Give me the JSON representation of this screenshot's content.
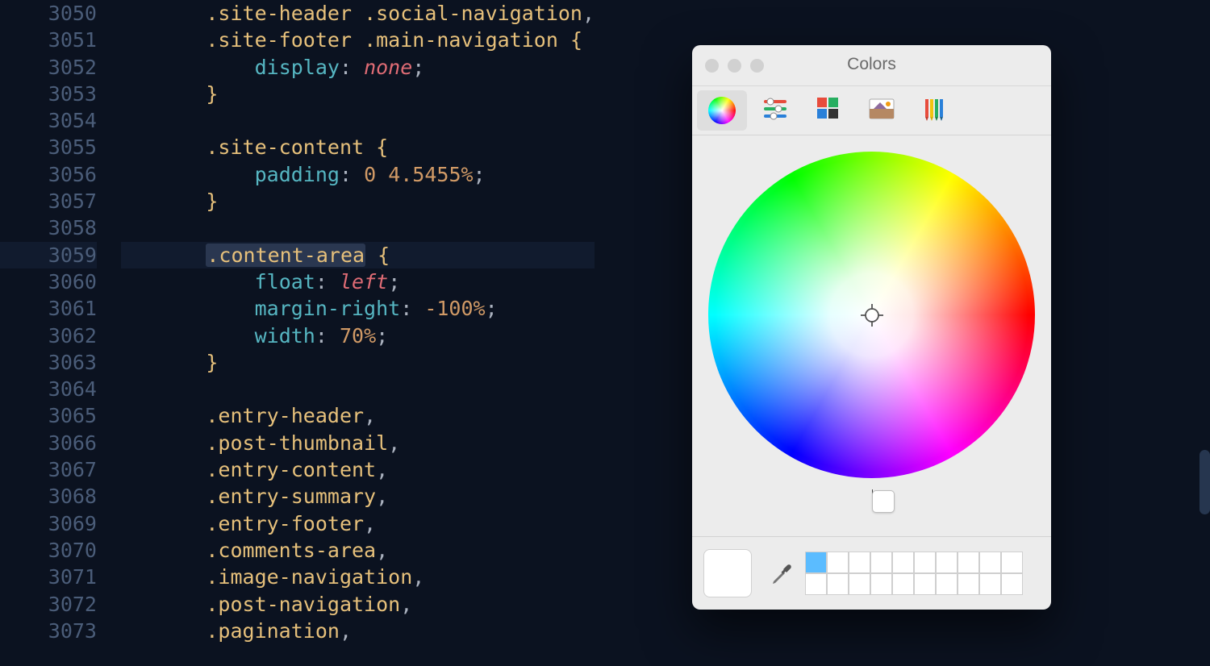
{
  "editor": {
    "gutter_start": 3050,
    "gutter_count": 24,
    "current_line": 3059,
    "lines": [
      {
        "n": 3050,
        "tokens": [
          {
            "t": "ind",
            "v": "····"
          },
          {
            "t": "sel",
            "v": ".site-header"
          },
          {
            "t": "punct",
            "v": " "
          },
          {
            "t": "sel",
            "v": ".social-navigation"
          },
          {
            "t": "punct",
            "v": ","
          }
        ]
      },
      {
        "n": 3051,
        "tokens": [
          {
            "t": "ind",
            "v": "····"
          },
          {
            "t": "sel",
            "v": ".site-footer"
          },
          {
            "t": "punct",
            "v": " "
          },
          {
            "t": "sel",
            "v": ".main-navigation"
          },
          {
            "t": "punct",
            "v": " "
          },
          {
            "t": "brace",
            "v": "{"
          }
        ]
      },
      {
        "n": 3052,
        "tokens": [
          {
            "t": "ind",
            "v": "····"
          },
          {
            "t": "ind",
            "v": "····"
          },
          {
            "t": "prop",
            "v": "display"
          },
          {
            "t": "punct",
            "v": ": "
          },
          {
            "t": "kw-it",
            "v": "none"
          },
          {
            "t": "punct",
            "v": ";"
          }
        ]
      },
      {
        "n": 3053,
        "tokens": [
          {
            "t": "ind",
            "v": "····"
          },
          {
            "t": "brace",
            "v": "}"
          }
        ]
      },
      {
        "n": 3054,
        "tokens": []
      },
      {
        "n": 3055,
        "tokens": [
          {
            "t": "ind",
            "v": "····"
          },
          {
            "t": "sel",
            "v": ".site-content"
          },
          {
            "t": "punct",
            "v": " "
          },
          {
            "t": "brace",
            "v": "{"
          }
        ]
      },
      {
        "n": 3056,
        "tokens": [
          {
            "t": "ind",
            "v": "····"
          },
          {
            "t": "ind",
            "v": "····"
          },
          {
            "t": "prop",
            "v": "padding"
          },
          {
            "t": "punct",
            "v": ": "
          },
          {
            "t": "num",
            "v": "0"
          },
          {
            "t": "punct",
            "v": " "
          },
          {
            "t": "num",
            "v": "4.5455%"
          },
          {
            "t": "punct",
            "v": ";"
          }
        ]
      },
      {
        "n": 3057,
        "tokens": [
          {
            "t": "ind",
            "v": "····"
          },
          {
            "t": "brace",
            "v": "}"
          }
        ]
      },
      {
        "n": 3058,
        "tokens": []
      },
      {
        "n": 3059,
        "cur": true,
        "tokens": [
          {
            "t": "ind",
            "v": "····"
          },
          {
            "t": "hl",
            "v": ".content-area"
          },
          {
            "t": "punct",
            "v": " "
          },
          {
            "t": "brace",
            "v": "{"
          }
        ]
      },
      {
        "n": 3060,
        "tokens": [
          {
            "t": "ind",
            "v": "····"
          },
          {
            "t": "ind",
            "v": "····"
          },
          {
            "t": "prop",
            "v": "float"
          },
          {
            "t": "punct",
            "v": ": "
          },
          {
            "t": "kw-it",
            "v": "left"
          },
          {
            "t": "punct",
            "v": ";"
          }
        ]
      },
      {
        "n": 3061,
        "tokens": [
          {
            "t": "ind",
            "v": "····"
          },
          {
            "t": "ind",
            "v": "····"
          },
          {
            "t": "prop",
            "v": "margin-right"
          },
          {
            "t": "punct",
            "v": ": "
          },
          {
            "t": "num",
            "v": "-100%"
          },
          {
            "t": "punct",
            "v": ";"
          }
        ]
      },
      {
        "n": 3062,
        "tokens": [
          {
            "t": "ind",
            "v": "····"
          },
          {
            "t": "ind",
            "v": "····"
          },
          {
            "t": "prop",
            "v": "width"
          },
          {
            "t": "punct",
            "v": ": "
          },
          {
            "t": "num",
            "v": "70%"
          },
          {
            "t": "punct",
            "v": ";"
          }
        ]
      },
      {
        "n": 3063,
        "tokens": [
          {
            "t": "ind",
            "v": "····"
          },
          {
            "t": "brace",
            "v": "}"
          }
        ]
      },
      {
        "n": 3064,
        "tokens": []
      },
      {
        "n": 3065,
        "tokens": [
          {
            "t": "ind",
            "v": "····"
          },
          {
            "t": "sel",
            "v": ".entry-header"
          },
          {
            "t": "punct",
            "v": ","
          }
        ]
      },
      {
        "n": 3066,
        "tokens": [
          {
            "t": "ind",
            "v": "····"
          },
          {
            "t": "sel",
            "v": ".post-thumbnail"
          },
          {
            "t": "punct",
            "v": ","
          }
        ]
      },
      {
        "n": 3067,
        "tokens": [
          {
            "t": "ind",
            "v": "····"
          },
          {
            "t": "sel",
            "v": ".entry-content"
          },
          {
            "t": "punct",
            "v": ","
          }
        ]
      },
      {
        "n": 3068,
        "tokens": [
          {
            "t": "ind",
            "v": "····"
          },
          {
            "t": "sel",
            "v": ".entry-summary"
          },
          {
            "t": "punct",
            "v": ","
          }
        ]
      },
      {
        "n": 3069,
        "tokens": [
          {
            "t": "ind",
            "v": "····"
          },
          {
            "t": "sel",
            "v": ".entry-footer"
          },
          {
            "t": "punct",
            "v": ","
          }
        ]
      },
      {
        "n": 3070,
        "tokens": [
          {
            "t": "ind",
            "v": "····"
          },
          {
            "t": "sel",
            "v": ".comments-area"
          },
          {
            "t": "punct",
            "v": ","
          }
        ]
      },
      {
        "n": 3071,
        "tokens": [
          {
            "t": "ind",
            "v": "····"
          },
          {
            "t": "sel",
            "v": ".image-navigation"
          },
          {
            "t": "punct",
            "v": ","
          }
        ]
      },
      {
        "n": 3072,
        "tokens": [
          {
            "t": "ind",
            "v": "····"
          },
          {
            "t": "sel",
            "v": ".post-navigation"
          },
          {
            "t": "punct",
            "v": ","
          }
        ]
      },
      {
        "n": 3073,
        "tokens": [
          {
            "t": "ind",
            "v": "····"
          },
          {
            "t": "sel",
            "v": ".pagination"
          },
          {
            "t": "punct",
            "v": ","
          }
        ]
      }
    ]
  },
  "colors_window": {
    "title": "Colors",
    "tabs": [
      {
        "name": "color-wheel-icon",
        "active": true
      },
      {
        "name": "sliders-icon",
        "active": false
      },
      {
        "name": "palettes-icon",
        "active": false
      },
      {
        "name": "image-icon",
        "active": false
      },
      {
        "name": "pencils-icon",
        "active": false
      }
    ],
    "brightness_value": 1.0,
    "current_swatch": "#ffffff",
    "saved_swatches": [
      "#5bbcff",
      "",
      "",
      "",
      "",
      "",
      "",
      "",
      "",
      "",
      "",
      "",
      "",
      "",
      "",
      "",
      "",
      "",
      "",
      ""
    ]
  }
}
